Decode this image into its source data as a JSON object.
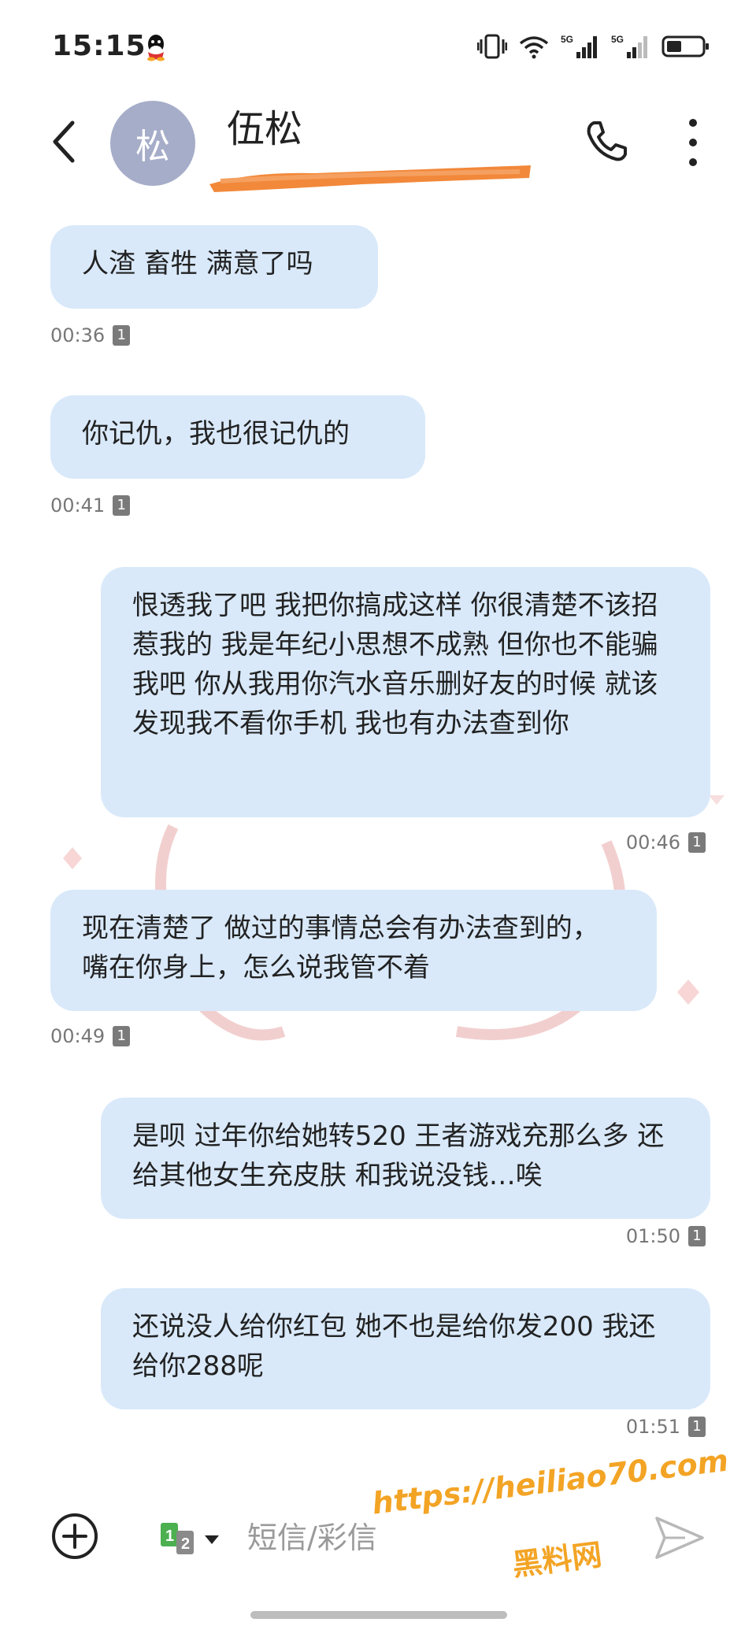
{
  "status_bar": {
    "time": "15:15",
    "network_1": "5G",
    "network_2": "5G"
  },
  "header": {
    "avatar_letter": "松",
    "contact_name": "伍松",
    "back_icon": "chevron-left-icon",
    "call_icon": "phone-icon",
    "more_icon": "more-vertical-icon"
  },
  "messages": [
    {
      "direction": "in",
      "text": "人渣 畜牲 满意了吗",
      "time": "00:36",
      "sim": "1"
    },
    {
      "direction": "in",
      "text": "你记仇，我也很记仇的",
      "time": "00:41",
      "sim": "1"
    },
    {
      "direction": "out",
      "text": "恨透我了吧 我把你搞成这样 你很清楚不该招惹我的 我是年纪小思想不成熟 但你也不能骗我吧 你从我用你汽水音乐删好友的时候 就该发现我不看你手机 我也有办法查到你",
      "time": "00:46",
      "sim": "1"
    },
    {
      "direction": "in",
      "text": "现在清楚了  做过的事情总会有办法查到的，嘴在你身上，怎么说我管不着",
      "time": "00:49",
      "sim": "1"
    },
    {
      "direction": "out",
      "text": "是呗 过年你给她转520 王者游戏充那么多 还给其他女生充皮肤 和我说没钱…唉",
      "time": "01:50",
      "sim": "1"
    },
    {
      "direction": "out",
      "text": "还说没人给你红包 她不也是给你发200 我还给你288呢",
      "time": "01:51",
      "sim": "1"
    }
  ],
  "composer": {
    "placeholder": "短信/彩信",
    "sim_select_label": "12",
    "add_icon": "plus-circle-icon",
    "send_icon": "send-icon"
  },
  "watermark": {
    "line1": "https://heiliao70.com",
    "line2": "黑料网"
  },
  "colors": {
    "bubble": "#d9e9fa",
    "watermark": "#f3a425",
    "redaction": "#f2883a",
    "avatar": "#a6adc9"
  }
}
